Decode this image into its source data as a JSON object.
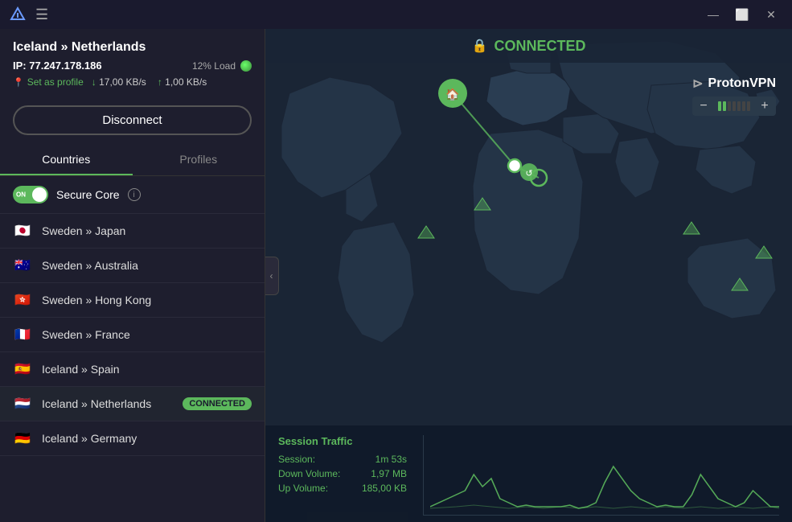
{
  "titlebar": {
    "logo": "⟁",
    "menu_icon": "☰",
    "minimize_label": "—",
    "maximize_label": "⬜",
    "close_label": "✕"
  },
  "connection": {
    "title": "Iceland » Netherlands",
    "ip_label": "IP:",
    "ip_value": "77.247.178.186",
    "load_label": "12% Load",
    "set_profile_label": "Set as profile",
    "download_speed": "17,00 KB/s",
    "upload_speed": "1,00 KB/s",
    "disconnect_label": "Disconnect"
  },
  "tabs": {
    "countries_label": "Countries",
    "profiles_label": "Profiles",
    "active": "countries"
  },
  "secure_core": {
    "label": "Secure Core",
    "toggle_on_label": "ON",
    "enabled": true,
    "info_label": "i"
  },
  "servers": [
    {
      "id": "sweden-japan",
      "flag": "🇯🇵",
      "name": "Sweden » Japan",
      "connected": false
    },
    {
      "id": "sweden-australia",
      "flag": "🇦🇺",
      "name": "Sweden » Australia",
      "connected": false
    },
    {
      "id": "sweden-hongkong",
      "flag": "🇭🇰",
      "name": "Sweden » Hong Kong",
      "connected": false
    },
    {
      "id": "sweden-france",
      "flag": "🇫🇷",
      "name": "Sweden » France",
      "connected": false
    },
    {
      "id": "iceland-spain",
      "flag": "🇪🇸",
      "name": "Iceland » Spain",
      "connected": false
    },
    {
      "id": "iceland-netherlands",
      "flag": "🇳🇱",
      "name": "Iceland » Netherlands",
      "connected": true,
      "badge": "CONNECTED"
    },
    {
      "id": "iceland-germany",
      "flag": "🇩🇪",
      "name": "Iceland » Germany",
      "connected": false
    }
  ],
  "map": {
    "connected_label": "CONNECTED",
    "brand_name": "ProtonVPN",
    "zoom_minus": "−",
    "zoom_plus": "+"
  },
  "traffic": {
    "section_title": "Session Traffic",
    "session_label": "Session:",
    "session_value": "1m 53s",
    "down_label": "Down Volume:",
    "down_value": "1,97   MB",
    "up_label": "Up Volume:",
    "up_value": "185,00  KB"
  }
}
